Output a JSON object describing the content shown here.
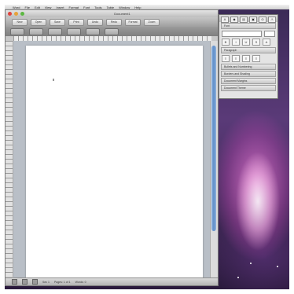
{
  "menubar": {
    "items": [
      "Word",
      "File",
      "Edit",
      "View",
      "Insert",
      "Format",
      "Font",
      "Tools",
      "Table",
      "Window",
      "Help"
    ]
  },
  "window": {
    "title": "Document1"
  },
  "toolbar": {
    "buttons": [
      "New",
      "Open",
      "Save",
      "Print",
      "Undo",
      "Redo",
      "Format",
      "Zoom"
    ]
  },
  "toolbox": {
    "tabs": [
      "",
      "",
      "",
      "",
      "",
      ""
    ],
    "sections": [
      "Font",
      "Paragraph",
      "Bullets and Numbering",
      "Borders and Shading",
      "Document Margins",
      "Document Theme"
    ]
  },
  "statusbar": {
    "items": [
      "Sec 1",
      "Pages: 1 of 1",
      "Words: 0"
    ]
  },
  "colors": {
    "close": "#e0443e",
    "minimize": "#e6a23a",
    "zoom": "#5cb842",
    "scroll_thumb": "#5f8ec9"
  }
}
